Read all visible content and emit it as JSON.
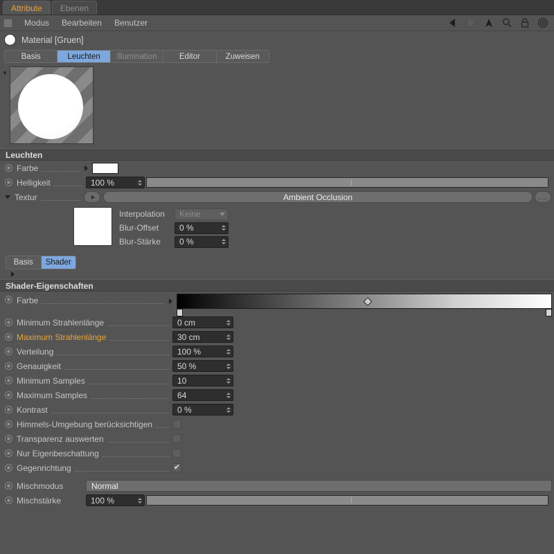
{
  "window": {
    "tabs": [
      {
        "label": "Attribute",
        "active": true
      },
      {
        "label": "Ebenen",
        "active": false
      }
    ]
  },
  "menu": {
    "items": [
      "Modus",
      "Bearbeiten",
      "Benutzer"
    ],
    "icons": [
      "back-arrow-icon",
      "forward-arrow-icon",
      "up-arrow-icon",
      "search-icon",
      "lock-icon",
      "target-icon"
    ]
  },
  "object": {
    "title": "Material [Gruen]",
    "tabs": [
      {
        "label": "Basis",
        "active": false,
        "disabled": false
      },
      {
        "label": "Leuchten",
        "active": true,
        "disabled": false
      },
      {
        "label": "Illumination",
        "active": false,
        "disabled": true
      },
      {
        "label": "Editor",
        "active": false,
        "disabled": false
      },
      {
        "label": "Zuweisen",
        "active": false,
        "disabled": false
      }
    ]
  },
  "luminance": {
    "section_title": "Leuchten",
    "color_label": "Farbe",
    "color_value": "#ffffff",
    "brightness_label": "Helligkeit",
    "brightness_value": "100 %",
    "texture_label": "Textur",
    "texture_value": "Ambient Occlusion",
    "browse_label": "...",
    "interpolation_label": "Interpolation",
    "interpolation_value": "Keine",
    "blur_offset_label": "Blur-Offset",
    "blur_offset_value": "0 %",
    "blur_strength_label": "Blur-Stärke",
    "blur_strength_value": "0 %"
  },
  "shader": {
    "tabs": [
      {
        "label": "Basis",
        "active": false
      },
      {
        "label": "Shader",
        "active": true
      }
    ],
    "section_title": "Shader-Eigenschaften",
    "gradient_label": "Farbe",
    "gradient_start": "#000000",
    "gradient_end": "#ffffff",
    "gradient_marker_pos": "51%",
    "params": [
      {
        "label": "Minimum Strahlenlänge",
        "value": "0 cm",
        "modified": false
      },
      {
        "label": "Maximum Strahlenlänge",
        "value": "30 cm",
        "modified": true
      },
      {
        "label": "Verteilung",
        "value": "100 %",
        "modified": false
      },
      {
        "label": "Genauigkeit",
        "value": "50 %",
        "modified": false
      },
      {
        "label": "Minimum Samples",
        "value": "10",
        "modified": false
      },
      {
        "label": "Maximum Samples",
        "value": "64",
        "modified": false
      },
      {
        "label": "Kontrast",
        "value": "0 %",
        "modified": false
      }
    ],
    "checks": [
      {
        "label": "Himmels-Umgebung berücksichtigen",
        "checked": false
      },
      {
        "label": "Transparenz auswerten",
        "checked": false
      },
      {
        "label": "Nur Eigenbeschattung",
        "checked": false
      },
      {
        "label": "Gegenrichtung",
        "checked": true
      }
    ]
  },
  "mixing": {
    "mode_label": "Mischmodus",
    "mode_value": "Normal",
    "strength_label": "Mischstärke",
    "strength_value": "100 %"
  },
  "colors": {
    "accent_orange": "#e8a33d",
    "accent_blue": "#7da7dd",
    "background": "#545454"
  }
}
